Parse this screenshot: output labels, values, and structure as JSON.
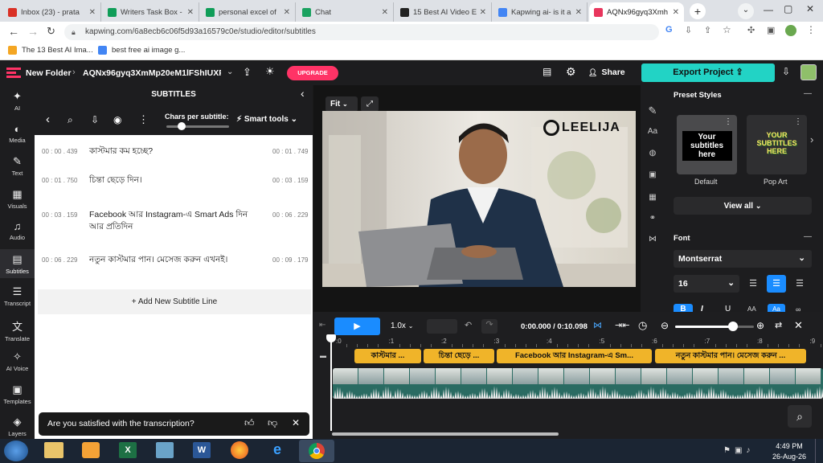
{
  "browser": {
    "tabs": [
      {
        "label": "Inbox (23) - prata",
        "icon": "gmail-icon",
        "color": "#d93025"
      },
      {
        "label": "Writers Task Box -",
        "icon": "sheets-icon",
        "color": "#0f9d58"
      },
      {
        "label": "personal excel of",
        "icon": "sheets-icon",
        "color": "#0f9d58"
      },
      {
        "label": "Chat",
        "icon": "chat-icon",
        "color": "#1aa260"
      },
      {
        "label": "15 Best AI Video E",
        "icon": "site-icon",
        "color": "#222222"
      },
      {
        "label": "Kapwing ai- is it a",
        "icon": "google-icon",
        "color": "#4285f4"
      },
      {
        "label": "AQNx96gyq3Xmh",
        "icon": "kapwing-icon",
        "color": "#e8365d"
      }
    ],
    "url": "kapwing.com/6a8ecb6c06f5d93a16579c0e/studio/editor/subtitles",
    "bookmarks": [
      {
        "label": "The 13 Best AI Ima...",
        "icon": "bookmark-site-icon",
        "color": "#f4a623"
      },
      {
        "label": "best free ai image g...",
        "icon": "doc-icon",
        "color": "#4285f4"
      }
    ]
  },
  "app": {
    "folder": "New Folder",
    "project": "AQNx96gyq3XmMp20eM1lFShIUXR...",
    "upgrade": "UPGRADE",
    "share": "Share",
    "export": "Export Project",
    "accent": "#22d3c5",
    "upgrade_color": "#ff3366"
  },
  "rail": [
    {
      "label": "AI",
      "icon": "sparkle-icon"
    },
    {
      "label": "Media",
      "icon": "media-icon"
    },
    {
      "label": "Text",
      "icon": "text-icon"
    },
    {
      "label": "Visuals",
      "icon": "visuals-icon"
    },
    {
      "label": "Audio",
      "icon": "audio-icon"
    },
    {
      "label": "Subtitles",
      "icon": "subtitles-icon"
    },
    {
      "label": "Transcript",
      "icon": "transcript-icon"
    },
    {
      "label": "Translate",
      "icon": "translate-icon"
    },
    {
      "label": "AI Voice",
      "icon": "voice-icon"
    },
    {
      "label": "Templates",
      "icon": "templates-icon"
    },
    {
      "label": "Layers",
      "icon": "layers-icon"
    }
  ],
  "subtitles": {
    "title": "SUBTITLES",
    "chars_label": "Chars per subtitle:",
    "smart_tools": "Smart tools",
    "rows": [
      {
        "start": "00 : 00 . 439",
        "end": "00 : 01 . 749",
        "text": "কাস্টমার কম হচ্ছে?"
      },
      {
        "start": "00 : 01 . 750",
        "end": "00 : 03 . 159",
        "text": "চিন্তা ছেড়ে দিন।"
      },
      {
        "start": "00 : 03 . 159",
        "end": "00 : 06 . 229",
        "text": "Facebook আর Instagram-এ Smart Ads দিন আর প্রতিদিন"
      },
      {
        "start": "00 : 06 . 229",
        "end": "00 : 09 . 179",
        "text": "নতুন কাস্টমার পান। মেসেজ করুন এখনই।"
      }
    ],
    "add_line": "+ Add New Subtitle Line",
    "toast": "Are you satisfied with the transcription?"
  },
  "canvas": {
    "fit": "Fit",
    "watermark": "LEELIJA"
  },
  "right_panel": {
    "preset_styles": "Preset Styles",
    "presets": [
      {
        "name": "Default",
        "preview": "Your subtitles here"
      },
      {
        "name": "Pop Art",
        "preview": "YOUR SUBTITLES HERE"
      }
    ],
    "view_all": "View all",
    "font_label": "Font",
    "font_name": "Montserrat",
    "font_size": "16",
    "bold": "B",
    "italic": "I",
    "underline": "U",
    "aa": "AA",
    "aa2": "Aa"
  },
  "timeline": {
    "speed": "1.0x",
    "time": "0:00.000 / 0:10.098",
    "ruler": [
      ":0",
      ":1",
      ":2",
      ":3",
      ":4",
      ":5",
      ":6",
      ":7",
      ":8",
      ":9"
    ],
    "clips": [
      "কাস্টমার ...",
      "চিন্তা ছেড়ে ...",
      "Facebook আর Instagram-এ Sm...",
      "নতুন কাস্টমার পান। মেসেজ করুন ..."
    ],
    "zoom_fraction": 0.73
  },
  "taskbar": {
    "time": "4:49 PM",
    "date": "26-Aug-26"
  }
}
